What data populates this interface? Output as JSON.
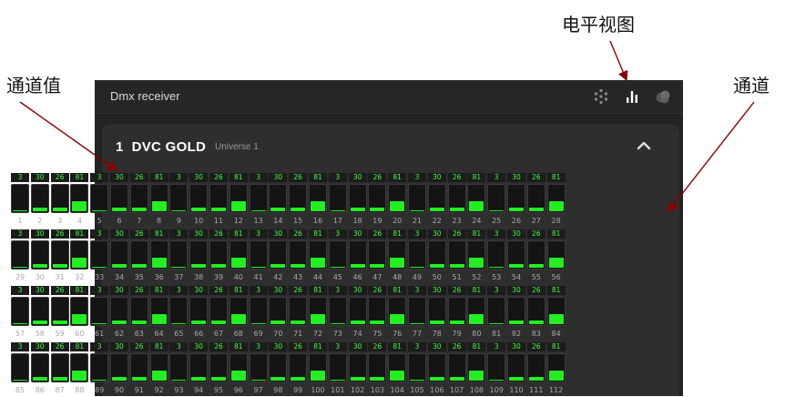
{
  "annotations": {
    "level_view": "电平视图",
    "channel_value": "通道值",
    "channel": "通道"
  },
  "window": {
    "title": "Dmx receiver",
    "icons": [
      "dots-grid-icon",
      "bar-chart-icon",
      "color-circles-icon"
    ]
  },
  "fixture": {
    "index": "1",
    "name": "DVC GOLD",
    "universe": "Universe 1"
  },
  "channels": [
    {
      "num": "1",
      "value": 3
    },
    {
      "num": "2",
      "value": 30
    },
    {
      "num": "3",
      "value": 26
    },
    {
      "num": "4",
      "value": 81
    },
    {
      "num": "5",
      "value": 3
    },
    {
      "num": "6",
      "value": 30
    },
    {
      "num": "7",
      "value": 26
    },
    {
      "num": "8",
      "value": 81
    },
    {
      "num": "9",
      "value": 3
    },
    {
      "num": "10",
      "value": 30
    },
    {
      "num": "11",
      "value": 26
    },
    {
      "num": "12",
      "value": 81
    },
    {
      "num": "13",
      "value": 3
    },
    {
      "num": "14",
      "value": 30
    },
    {
      "num": "15",
      "value": 26
    },
    {
      "num": "16",
      "value": 81
    },
    {
      "num": "17",
      "value": 3
    },
    {
      "num": "18",
      "value": 30
    },
    {
      "num": "19",
      "value": 26
    },
    {
      "num": "20",
      "value": 81
    },
    {
      "num": "21",
      "value": 3
    },
    {
      "num": "22",
      "value": 30
    },
    {
      "num": "23",
      "value": 26
    },
    {
      "num": "24",
      "value": 81
    },
    {
      "num": "25",
      "value": 3
    },
    {
      "num": "26",
      "value": 30
    },
    {
      "num": "27",
      "value": 26
    },
    {
      "num": "28",
      "value": 81
    },
    {
      "num": "29",
      "value": 3
    },
    {
      "num": "30",
      "value": 30
    },
    {
      "num": "31",
      "value": 26
    },
    {
      "num": "32",
      "value": 81
    },
    {
      "num": "33",
      "value": 3
    },
    {
      "num": "34",
      "value": 30
    },
    {
      "num": "35",
      "value": 26
    },
    {
      "num": "36",
      "value": 81
    },
    {
      "num": "37",
      "value": 3
    },
    {
      "num": "38",
      "value": 30
    },
    {
      "num": "39",
      "value": 26
    },
    {
      "num": "40",
      "value": 81
    },
    {
      "num": "41",
      "value": 3
    },
    {
      "num": "42",
      "value": 30
    },
    {
      "num": "43",
      "value": 26
    },
    {
      "num": "44",
      "value": 81
    },
    {
      "num": "45",
      "value": 3
    },
    {
      "num": "46",
      "value": 30
    },
    {
      "num": "47",
      "value": 26
    },
    {
      "num": "48",
      "value": 81
    },
    {
      "num": "49",
      "value": 3
    },
    {
      "num": "50",
      "value": 30
    },
    {
      "num": "51",
      "value": 26
    },
    {
      "num": "52",
      "value": 81
    },
    {
      "num": "53",
      "value": 3
    },
    {
      "num": "54",
      "value": 30
    },
    {
      "num": "55",
      "value": 26
    },
    {
      "num": "56",
      "value": 81
    },
    {
      "num": "57",
      "value": 3
    },
    {
      "num": "58",
      "value": 30
    },
    {
      "num": "59",
      "value": 26
    },
    {
      "num": "60",
      "value": 81
    },
    {
      "num": "61",
      "value": 3
    },
    {
      "num": "62",
      "value": 30
    },
    {
      "num": "63",
      "value": 26
    },
    {
      "num": "64",
      "value": 81
    },
    {
      "num": "65",
      "value": 3
    },
    {
      "num": "66",
      "value": 30
    },
    {
      "num": "67",
      "value": 26
    },
    {
      "num": "68",
      "value": 81
    },
    {
      "num": "69",
      "value": 3
    },
    {
      "num": "70",
      "value": 30
    },
    {
      "num": "71",
      "value": 26
    },
    {
      "num": "72",
      "value": 81
    },
    {
      "num": "73",
      "value": 3
    },
    {
      "num": "74",
      "value": 30
    },
    {
      "num": "75",
      "value": 26
    },
    {
      "num": "76",
      "value": 81
    },
    {
      "num": "77",
      "value": 3
    },
    {
      "num": "78",
      "value": 30
    },
    {
      "num": "79",
      "value": 26
    },
    {
      "num": "80",
      "value": 81
    },
    {
      "num": "81",
      "value": 3
    },
    {
      "num": "82",
      "value": 30
    },
    {
      "num": "83",
      "value": 26
    },
    {
      "num": "84",
      "value": 81
    },
    {
      "num": "85",
      "value": 3
    },
    {
      "num": "86",
      "value": 30
    },
    {
      "num": "87",
      "value": 26
    },
    {
      "num": "88",
      "value": 81
    },
    {
      "num": "89",
      "value": 3
    },
    {
      "num": "90",
      "value": 30
    },
    {
      "num": "91",
      "value": 26
    },
    {
      "num": "92",
      "value": 81
    },
    {
      "num": "93",
      "value": 3
    },
    {
      "num": "94",
      "value": 30
    },
    {
      "num": "95",
      "value": 26
    },
    {
      "num": "96",
      "value": 81
    },
    {
      "num": "97",
      "value": 3
    },
    {
      "num": "98",
      "value": 30
    },
    {
      "num": "99",
      "value": 26
    },
    {
      "num": "100",
      "value": 81
    },
    {
      "num": "101",
      "value": 3
    },
    {
      "num": "102",
      "value": 30
    },
    {
      "num": "103",
      "value": 26
    },
    {
      "num": "104",
      "value": 81
    },
    {
      "num": "105",
      "value": 3
    },
    {
      "num": "106",
      "value": 30
    },
    {
      "num": "107",
      "value": 26
    },
    {
      "num": "108",
      "value": 81
    },
    {
      "num": "109",
      "value": 3
    },
    {
      "num": "110",
      "value": 30
    },
    {
      "num": "111",
      "value": 26
    },
    {
      "num": "112",
      "value": 81
    }
  ],
  "colors": {
    "level_fill": "#22ee22",
    "value_text": "#3bff3b",
    "annotation_arrow": "#8b0000"
  }
}
